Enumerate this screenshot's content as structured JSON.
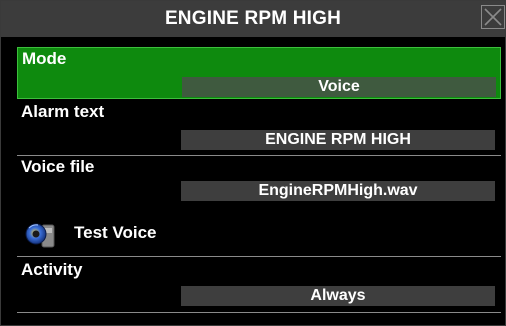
{
  "dialog": {
    "title": "ENGINE RPM HIGH"
  },
  "rows": {
    "mode": {
      "label": "Mode",
      "value": "Voice"
    },
    "alarm_text": {
      "label": "Alarm text",
      "value": "ENGINE RPM HIGH"
    },
    "voice_file": {
      "label": "Voice file",
      "value": "EngineRPMHigh.wav"
    },
    "activity": {
      "label": "Activity",
      "value": "Always"
    }
  },
  "test_voice": {
    "label": "Test Voice",
    "icon": "speaker-icon"
  },
  "colors": {
    "selected_row": "#0e8a0e",
    "value_box": "#3e3e3e",
    "titlebar": "#3c3c3c"
  }
}
